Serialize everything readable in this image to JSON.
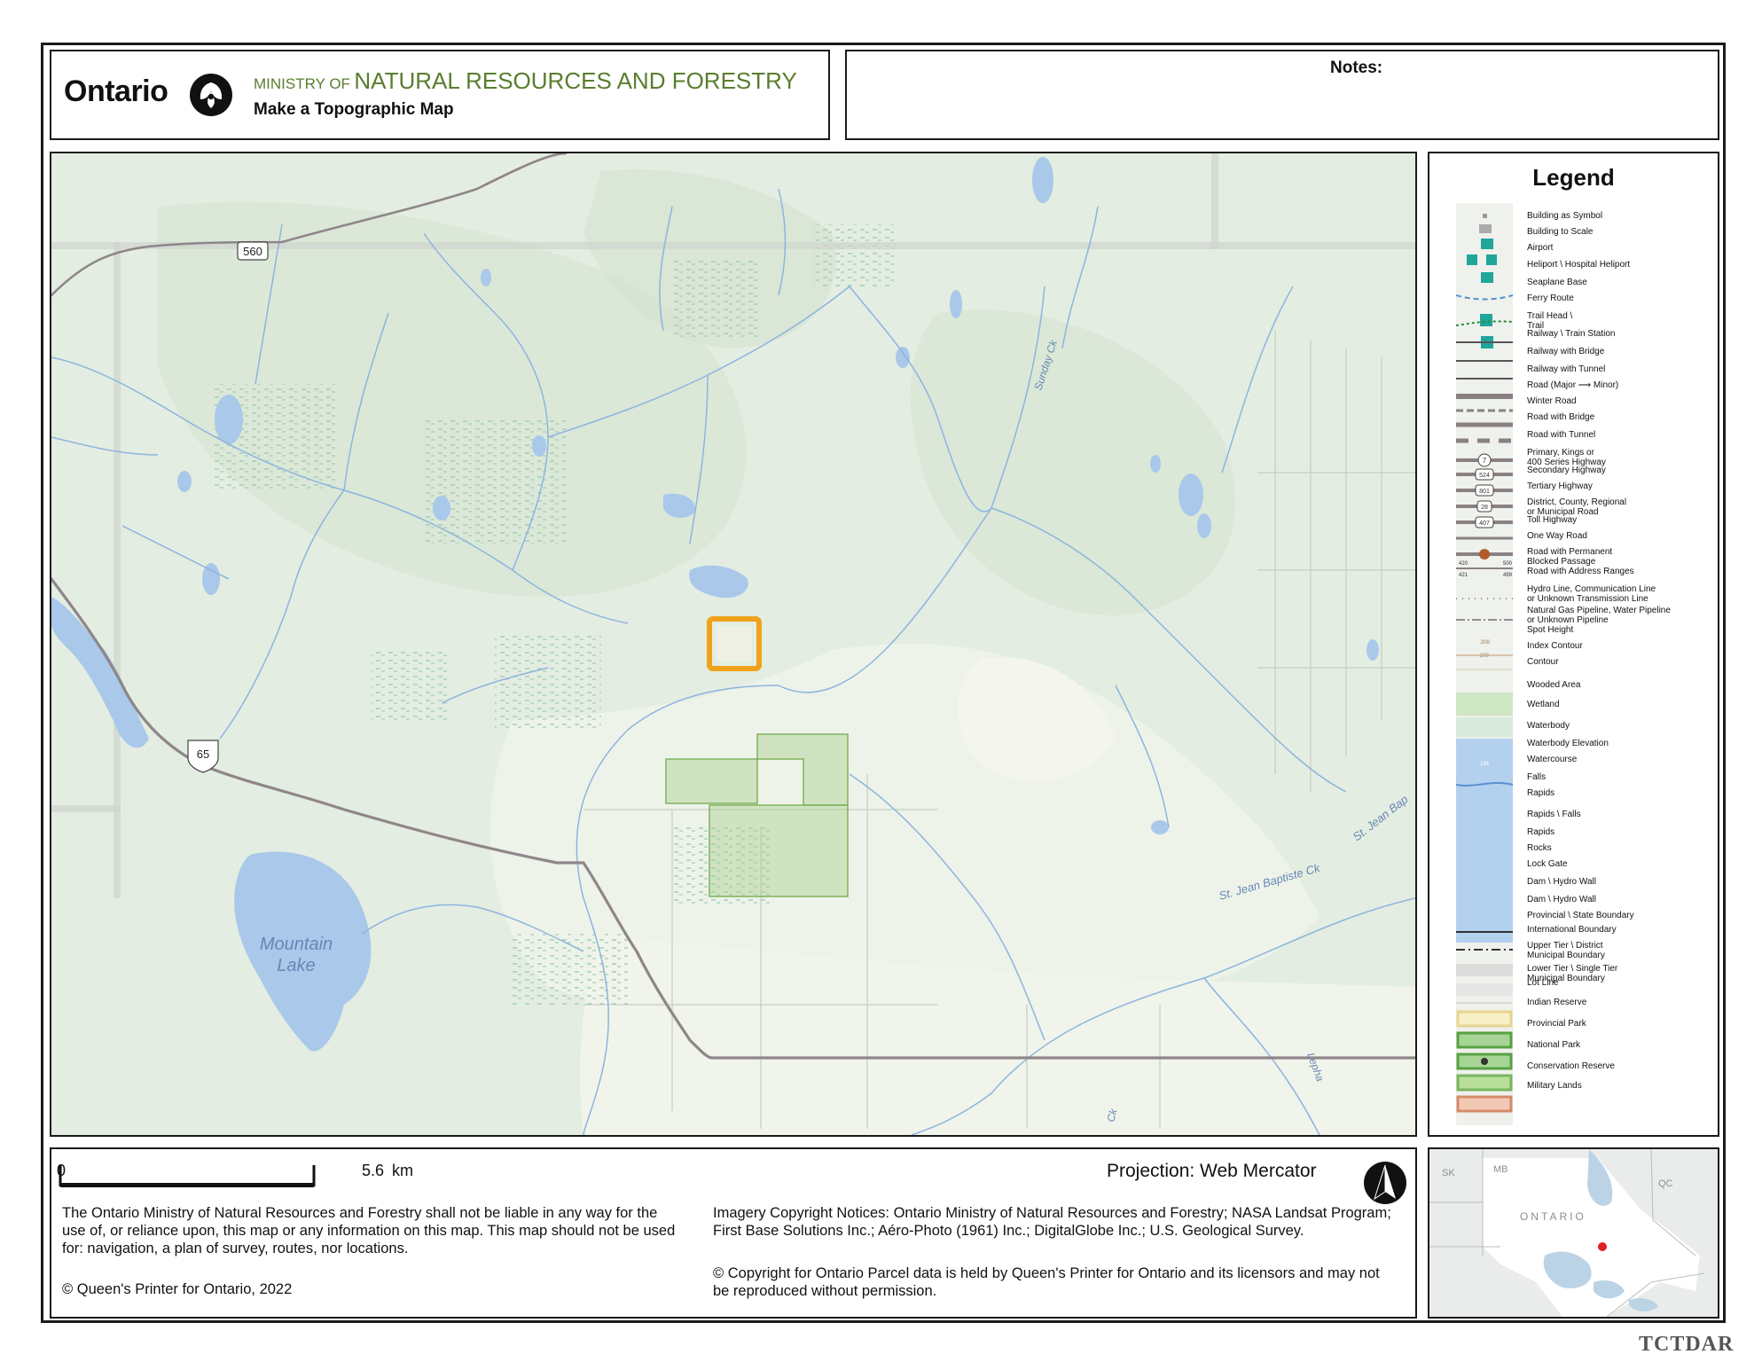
{
  "header": {
    "wordmark": "Ontario",
    "ministry_prefix": "MINISTRY OF",
    "ministry_name": "NATURAL RESOURCES AND FORESTRY",
    "map_title": "Make a Topographic Map"
  },
  "notes": {
    "label": "Notes:"
  },
  "map": {
    "labels": {
      "highway_560": "560",
      "highway_65": "65",
      "lake_name_1": "Mountain",
      "lake_name_2": "Lake",
      "creek_sunday": "Sunday Ck",
      "creek_st_jean_1": "St. Jean Baptiste Ck",
      "creek_st_jean_2": "St. Jean Bap",
      "creek_lepha": "Lepha",
      "creek_ck": "Ck"
    },
    "colors": {
      "land": "#e4ede1",
      "water": "#a9c8ea",
      "highlight": "#f0a21a",
      "road": "#8f8689",
      "parcel": "#a9d08e"
    }
  },
  "legend": {
    "title": "Legend",
    "items": [
      "Building as Symbol",
      "Building to Scale",
      "Airport",
      "Heliport \\ Hospital Heliport",
      "Seaplane Base",
      "Ferry Route",
      "Trail Head \\\nTrail",
      "Railway \\ Train Station",
      "Railway with Bridge",
      "Railway with Tunnel",
      "Road (Major ⟶ Minor)",
      "Winter Road",
      "Road with Bridge",
      "Road with Tunnel",
      "Primary, Kings or\n400 Series Highway",
      "Secondary Highway",
      "Tertiary Highway",
      "District, County, Regional\nor Municipal Road",
      "Toll Highway",
      "One Way Road",
      "Road with Permanent\nBlocked Passage",
      "Road with Address Ranges",
      "Hydro Line, Communication Line\nor Unknown Transmission Line",
      "Natural Gas Pipeline, Water Pipeline\nor Unknown Pipeline",
      "Spot Height",
      "Index Contour",
      "Contour",
      "Wooded Area",
      "Wetland",
      "Waterbody",
      "Waterbody Elevation",
      "Watercourse",
      "Falls",
      "Rapids",
      "Rapids \\ Falls",
      "Rapids",
      "Rocks",
      "Lock Gate",
      "Dam \\ Hydro Wall",
      "Dam \\ Hydro Wall",
      "Provincial \\ State Boundary",
      "International Boundary",
      "Upper Tier \\ District\nMunicipal Boundary",
      "Lower Tier \\ Single Tier\nMunicipal Boundary",
      "Lot Line",
      "Indian Reserve",
      "Provincial Park",
      "National Park",
      "Conservation Reserve",
      "Military Lands"
    ],
    "symbol_numbers": {
      "primary": "7",
      "secondary": "524",
      "tertiary": "801",
      "district": "28",
      "toll": "407",
      "address_left_top": "420",
      "address_right_top": "500",
      "address_left_bottom": "421",
      "address_right_bottom": "499",
      "spot_height": ".208",
      "index_contour": "200",
      "waterbody_elevation": "134"
    }
  },
  "scale": {
    "start": "0",
    "end": "5.6",
    "unit": "km"
  },
  "projection": "Projection: Web Mercator",
  "disclaimer": "The Ontario Ministry of Natural Resources and Forestry shall not be liable in any way for the use of, or reliance upon, this map or any information on this map.  This map should not be used for: navigation, a plan of survey, routes, nor locations.",
  "copyright_left": "© Queen's Printer for Ontario, 2022",
  "imagery_notice": "Imagery Copyright Notices: Ontario Ministry of Natural Resources and Forestry; NASA Landsat Program; First Base Solutions Inc.; Aéro-Photo (1961) Inc.; DigitalGlobe Inc.; U.S. Geological Survey.",
  "parcel_notice": "© Copyright for Ontario Parcel data is held by Queen's Printer for Ontario and its licensors and may not be reproduced without permission.",
  "inset": {
    "labels": {
      "sk": "SK",
      "mb": "MB",
      "qc": "QC",
      "ontario": "ONTARIO"
    },
    "marker_color": "#e02020"
  },
  "watermark": "TCTDAR"
}
